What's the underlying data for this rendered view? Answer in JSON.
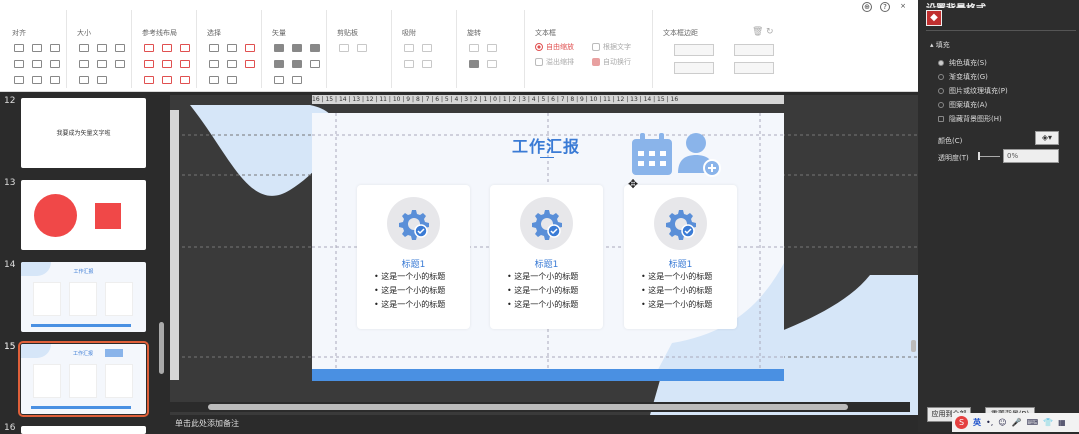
{
  "toolbar": {
    "groups": [
      {
        "title": "对齐"
      },
      {
        "title": "大小"
      },
      {
        "title": "参考线布局"
      },
      {
        "title": "选择"
      },
      {
        "title": "矢量"
      },
      {
        "title": "剪贴板"
      },
      {
        "title": "吸附"
      },
      {
        "title": "旋转"
      },
      {
        "title": "文本框"
      },
      {
        "title": "文本框边距"
      }
    ],
    "textbox": {
      "free_shrink": "自由缩放",
      "fit_text": "根据文字",
      "overflow_shrink": "溢出缩排",
      "auto_wrap": "自动换行"
    }
  },
  "thumbnails": [
    {
      "num": "12",
      "text": "我要成为矢量文字啦"
    },
    {
      "num": "13"
    },
    {
      "num": "14",
      "text": "工作汇报"
    },
    {
      "num": "15",
      "text": "工作汇报"
    },
    {
      "num": "16"
    }
  ],
  "ruler": {
    "labels": "16 | 15 | 14 | 13 | 12 | 11 | 10 | 9 | 8 | 7 | 6 | 5 | 4 | 3 | 2 | 1 | 0 | 1 | 2 | 3 | 4 | 5 | 6 | 7 | 8 | 9 | 10 | 11 | 12 | 13 | 14 | 15 | 16"
  },
  "slide": {
    "title": "工作汇报",
    "cards": [
      {
        "title": "标题1",
        "bullets": [
          "这是一个小的标题",
          "这是一个小的标题",
          "这是一个小的标题"
        ]
      },
      {
        "title": "标题1",
        "bullets": [
          "这是一个小的标题",
          "这是一个小的标题",
          "这是一个小的标题"
        ]
      },
      {
        "title": "标题1",
        "bullets": [
          "这是一个小的标题",
          "这是一个小的标题",
          "这是一个小的标题"
        ]
      }
    ]
  },
  "notes": {
    "placeholder": "单击此处添加备注"
  },
  "panel": {
    "title": "设置背景格式",
    "section": "填充",
    "options": [
      "纯色填充(S)",
      "渐变填充(G)",
      "图片或纹理填充(P)",
      "图案填充(A)",
      "隐藏背景图形(H)"
    ],
    "color_label": "颜色(C)",
    "transparency_label": "透明度(T)",
    "transparency_value": "0%",
    "apply_all": "应用到全部",
    "reset": "重置背景(B)"
  },
  "ime": {
    "lang": "英"
  },
  "colors": {
    "accent": "#e05050",
    "slide_blue": "#4a90e2",
    "selection": "#e0603a"
  }
}
